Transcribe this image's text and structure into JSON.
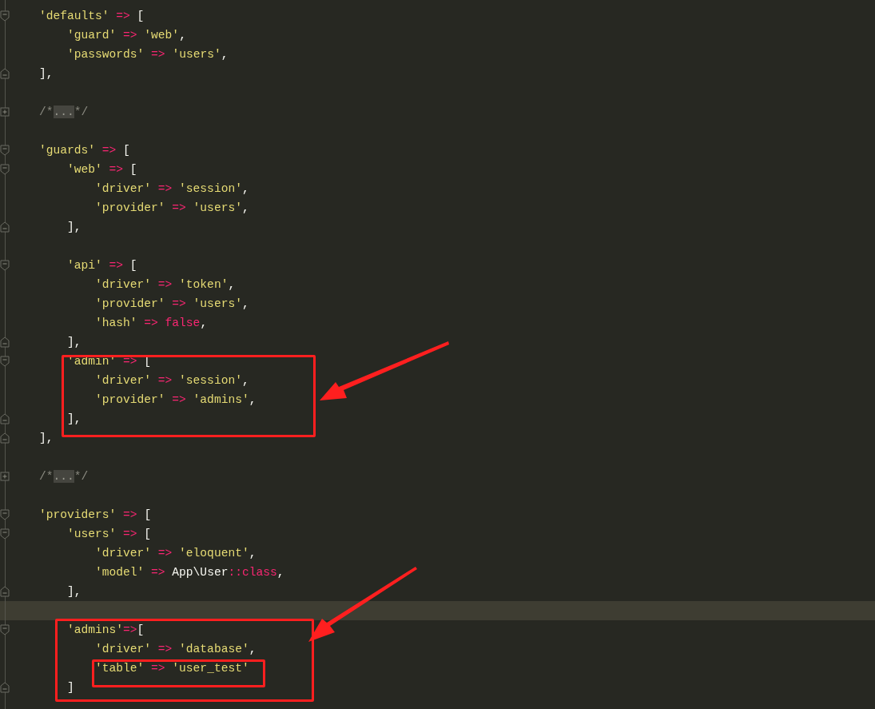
{
  "editor": {
    "lines": [
      {
        "kind": "open",
        "tokens": [
          {
            "kind": "string",
            "text": "'defaults'"
          },
          {
            "kind": "op",
            "text": " => "
          },
          {
            "kind": "punct",
            "text": "["
          }
        ],
        "children": [
          {
            "kind": "plain",
            "tokens": [
              {
                "kind": "string",
                "text": "'guard'"
              },
              {
                "kind": "op",
                "text": " => "
              },
              {
                "kind": "string",
                "text": "'web'"
              },
              {
                "kind": "punct",
                "text": ","
              }
            ]
          },
          {
            "kind": "plain",
            "tokens": [
              {
                "kind": "string",
                "text": "'passwords'"
              },
              {
                "kind": "op",
                "text": " => "
              },
              {
                "kind": "string",
                "text": "'users'"
              },
              {
                "kind": "punct",
                "text": ","
              }
            ]
          }
        ]
      },
      {
        "kind": "close",
        "tokens": [
          {
            "kind": "punct",
            "text": "],"
          }
        ]
      },
      {
        "kind": "blank"
      },
      {
        "kind": "collapsed",
        "tokens": [
          {
            "kind": "comment",
            "text": "/*"
          },
          {
            "kind": "folded",
            "text": "..."
          },
          {
            "kind": "comment",
            "text": "*/"
          }
        ]
      },
      {
        "kind": "blank"
      },
      {
        "kind": "open",
        "tokens": [
          {
            "kind": "string",
            "text": "'guards'"
          },
          {
            "kind": "op",
            "text": " => "
          },
          {
            "kind": "punct",
            "text": "["
          }
        ],
        "children": [
          {
            "kind": "open",
            "tokens": [
              {
                "kind": "string",
                "text": "'web'"
              },
              {
                "kind": "op",
                "text": " => "
              },
              {
                "kind": "punct",
                "text": "["
              }
            ],
            "children": [
              {
                "kind": "plain",
                "tokens": [
                  {
                    "kind": "string",
                    "text": "'driver'"
                  },
                  {
                    "kind": "op",
                    "text": " => "
                  },
                  {
                    "kind": "string",
                    "text": "'session'"
                  },
                  {
                    "kind": "punct",
                    "text": ","
                  }
                ]
              },
              {
                "kind": "plain",
                "tokens": [
                  {
                    "kind": "string",
                    "text": "'provider'"
                  },
                  {
                    "kind": "op",
                    "text": " => "
                  },
                  {
                    "kind": "string",
                    "text": "'users'"
                  },
                  {
                    "kind": "punct",
                    "text": ","
                  }
                ]
              }
            ]
          },
          {
            "kind": "close",
            "tokens": [
              {
                "kind": "punct",
                "text": "],"
              }
            ]
          },
          {
            "kind": "blank"
          },
          {
            "kind": "open",
            "tokens": [
              {
                "kind": "string",
                "text": "'api'"
              },
              {
                "kind": "op",
                "text": " => "
              },
              {
                "kind": "punct",
                "text": "["
              }
            ],
            "children": [
              {
                "kind": "plain",
                "tokens": [
                  {
                    "kind": "string",
                    "text": "'driver'"
                  },
                  {
                    "kind": "op",
                    "text": " => "
                  },
                  {
                    "kind": "string",
                    "text": "'token'"
                  },
                  {
                    "kind": "punct",
                    "text": ","
                  }
                ]
              },
              {
                "kind": "plain",
                "tokens": [
                  {
                    "kind": "string",
                    "text": "'provider'"
                  },
                  {
                    "kind": "op",
                    "text": " => "
                  },
                  {
                    "kind": "string",
                    "text": "'users'"
                  },
                  {
                    "kind": "punct",
                    "text": ","
                  }
                ]
              },
              {
                "kind": "plain",
                "tokens": [
                  {
                    "kind": "string",
                    "text": "'hash'"
                  },
                  {
                    "kind": "op",
                    "text": " => false"
                  },
                  {
                    "kind": "punct",
                    "text": ","
                  }
                ]
              }
            ]
          },
          {
            "kind": "close",
            "tokens": [
              {
                "kind": "punct",
                "text": "],"
              }
            ]
          },
          {
            "kind": "open",
            "tokens": [
              {
                "kind": "string",
                "text": "'admin'"
              },
              {
                "kind": "op",
                "text": " => "
              },
              {
                "kind": "punct",
                "text": "["
              }
            ],
            "children": [
              {
                "kind": "plain",
                "tokens": [
                  {
                    "kind": "string",
                    "text": "'driver'"
                  },
                  {
                    "kind": "op",
                    "text": " => "
                  },
                  {
                    "kind": "string",
                    "text": "'session'"
                  },
                  {
                    "kind": "punct",
                    "text": ","
                  }
                ]
              },
              {
                "kind": "plain",
                "tokens": [
                  {
                    "kind": "string",
                    "text": "'provider'"
                  },
                  {
                    "kind": "op",
                    "text": " => "
                  },
                  {
                    "kind": "string",
                    "text": "'admins'"
                  },
                  {
                    "kind": "punct",
                    "text": ","
                  }
                ]
              }
            ]
          },
          {
            "kind": "close",
            "tokens": [
              {
                "kind": "punct",
                "text": "],"
              }
            ]
          }
        ]
      },
      {
        "kind": "close",
        "tokens": [
          {
            "kind": "punct",
            "text": "],"
          }
        ]
      },
      {
        "kind": "blank"
      },
      {
        "kind": "collapsed",
        "tokens": [
          {
            "kind": "comment",
            "text": "/*"
          },
          {
            "kind": "folded",
            "text": "..."
          },
          {
            "kind": "comment",
            "text": "*/"
          }
        ]
      },
      {
        "kind": "blank"
      },
      {
        "kind": "open",
        "tokens": [
          {
            "kind": "string",
            "text": "'providers'"
          },
          {
            "kind": "op",
            "text": " => "
          },
          {
            "kind": "punct",
            "text": "["
          }
        ],
        "children": [
          {
            "kind": "open",
            "tokens": [
              {
                "kind": "string",
                "text": "'users'"
              },
              {
                "kind": "op",
                "text": " => "
              },
              {
                "kind": "punct",
                "text": "["
              }
            ],
            "children": [
              {
                "kind": "plain",
                "tokens": [
                  {
                    "kind": "string",
                    "text": "'driver'"
                  },
                  {
                    "kind": "op",
                    "text": " => "
                  },
                  {
                    "kind": "string",
                    "text": "'eloquent'"
                  },
                  {
                    "kind": "punct",
                    "text": ","
                  }
                ]
              },
              {
                "kind": "plain",
                "tokens": [
                  {
                    "kind": "string",
                    "text": "'model'"
                  },
                  {
                    "kind": "op",
                    "text": " => "
                  },
                  {
                    "kind": "punct",
                    "text": "App\\User"
                  },
                  {
                    "kind": "op",
                    "text": "::class"
                  },
                  {
                    "kind": "punct",
                    "text": ","
                  }
                ]
              }
            ]
          },
          {
            "kind": "close",
            "tokens": [
              {
                "kind": "punct",
                "text": "],"
              }
            ]
          },
          {
            "kind": "blank",
            "current": true
          },
          {
            "kind": "open",
            "tokens": [
              {
                "kind": "string",
                "text": "'admins'"
              },
              {
                "kind": "op",
                "text": "=>"
              },
              {
                "kind": "punct",
                "text": "["
              }
            ],
            "children": [
              {
                "kind": "plain",
                "tokens": [
                  {
                    "kind": "string",
                    "text": "'driver'"
                  },
                  {
                    "kind": "op",
                    "text": " => "
                  },
                  {
                    "kind": "string",
                    "text": "'database'"
                  },
                  {
                    "kind": "punct",
                    "text": ","
                  }
                ]
              },
              {
                "kind": "plain",
                "tokens": [
                  {
                    "kind": "string",
                    "text": "'table'"
                  },
                  {
                    "kind": "op",
                    "text": " => "
                  },
                  {
                    "kind": "string",
                    "text": "'user_test'"
                  }
                ]
              }
            ]
          },
          {
            "kind": "close",
            "tokens": [
              {
                "kind": "punct",
                "text": "]"
              }
            ]
          }
        ]
      }
    ]
  }
}
